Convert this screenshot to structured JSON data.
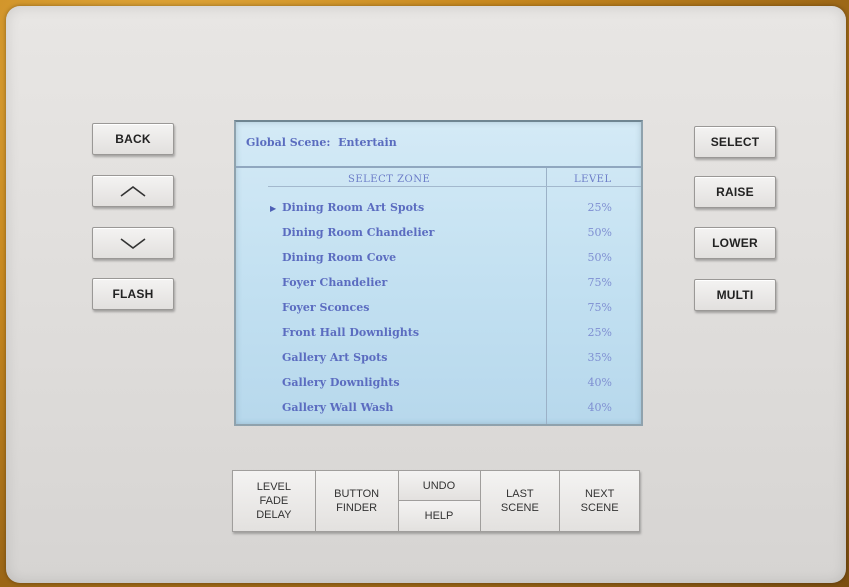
{
  "left_buttons": {
    "back": "BACK",
    "up_icon": "chevron-up-icon",
    "down_icon": "chevron-down-icon",
    "flash": "FLASH"
  },
  "right_buttons": {
    "select": "SELECT",
    "raise": "RAISE",
    "lower": "LOWER",
    "multi": "MULTI"
  },
  "screen": {
    "title": "Global Scene:  Entertain",
    "columns": {
      "zone": "SELECT ZONE",
      "level": "LEVEL"
    },
    "selected_marker": "▶",
    "zones": [
      {
        "name": "Dining Room Art Spots",
        "level": "25%"
      },
      {
        "name": "Dining Room Chandelier",
        "level": "50%"
      },
      {
        "name": "Dining Room Cove",
        "level": "50%"
      },
      {
        "name": "Foyer Chandelier",
        "level": "75%"
      },
      {
        "name": "Foyer Sconces",
        "level": "75%"
      },
      {
        "name": "Front Hall Downlights",
        "level": "25%"
      },
      {
        "name": "Gallery Art Spots",
        "level": "35%"
      },
      {
        "name": "Gallery Downlights",
        "level": "40%"
      },
      {
        "name": "Gallery Wall Wash",
        "level": "40%"
      }
    ]
  },
  "bottom_buttons": {
    "level_fade_delay": "LEVEL\nFADE\nDELAY",
    "button_finder": "BUTTON\nFINDER",
    "undo": "UNDO",
    "help": "HELP",
    "last_scene": "LAST\nSCENE",
    "next_scene": "NEXT\nSCENE"
  },
  "colors": {
    "panel": "#e2e0de",
    "screen_bg": "#c2e0f1",
    "screen_text": "#5668bb",
    "backdrop": "#c7881f"
  }
}
